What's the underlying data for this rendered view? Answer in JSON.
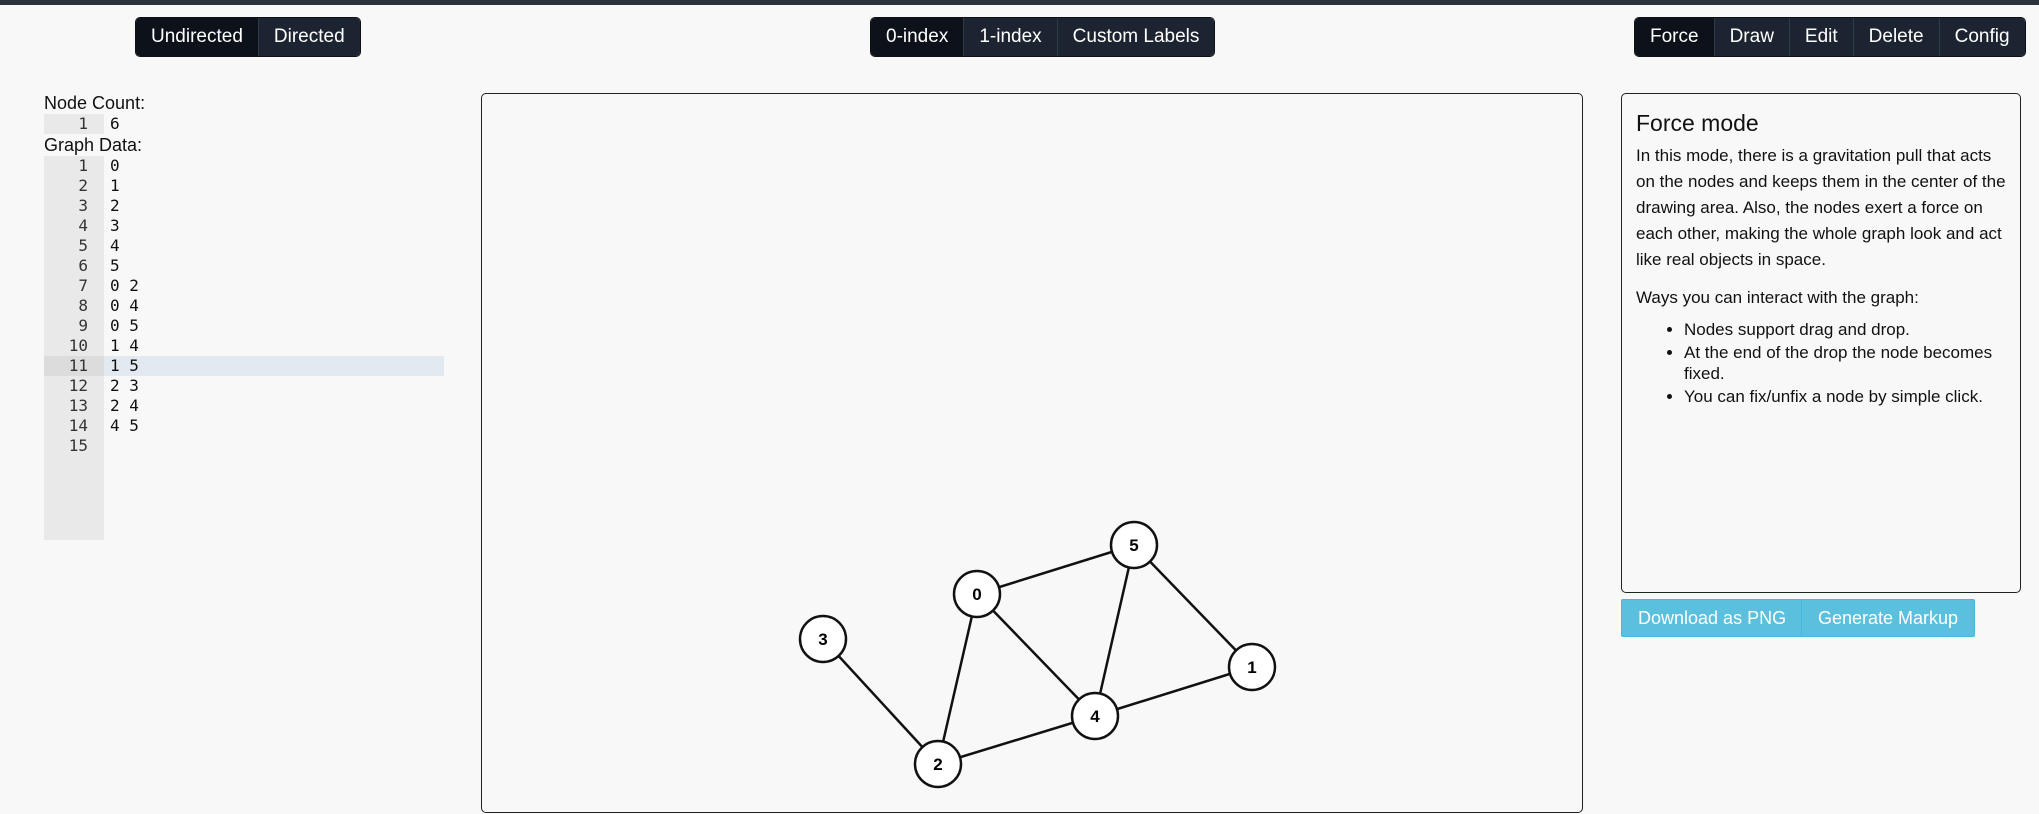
{
  "direction_toggle": {
    "buttons": [
      {
        "label": "Undirected"
      },
      {
        "label": "Directed"
      }
    ]
  },
  "index_toggle": {
    "buttons": [
      {
        "label": "0-index"
      },
      {
        "label": "1-index"
      },
      {
        "label": "Custom Labels"
      }
    ]
  },
  "mode_toggle": {
    "buttons": [
      {
        "label": "Force"
      },
      {
        "label": "Draw"
      },
      {
        "label": "Edit"
      },
      {
        "label": "Delete"
      },
      {
        "label": "Config"
      }
    ]
  },
  "node_count": {
    "label": "Node Count:",
    "lines": [
      {
        "num": "1",
        "text": "6"
      }
    ]
  },
  "graph_data": {
    "label": "Graph Data:",
    "lines": [
      {
        "num": "1",
        "text": "0"
      },
      {
        "num": "2",
        "text": "1"
      },
      {
        "num": "3",
        "text": "2"
      },
      {
        "num": "4",
        "text": "3"
      },
      {
        "num": "5",
        "text": "4"
      },
      {
        "num": "6",
        "text": "5"
      },
      {
        "num": "7",
        "text": "0 2"
      },
      {
        "num": "8",
        "text": "0 4"
      },
      {
        "num": "9",
        "text": "0 5"
      },
      {
        "num": "10",
        "text": "1 4"
      },
      {
        "num": "11",
        "text": "1 5"
      },
      {
        "num": "12",
        "text": "2 3"
      },
      {
        "num": "13",
        "text": "2 4"
      },
      {
        "num": "14",
        "text": "4 5"
      },
      {
        "num": "15",
        "text": ""
      }
    ]
  },
  "graph": {
    "nodes": [
      {
        "label": "0"
      },
      {
        "label": "1"
      },
      {
        "label": "2"
      },
      {
        "label": "3"
      },
      {
        "label": "4"
      },
      {
        "label": "5"
      }
    ]
  },
  "info": {
    "title": "Force mode",
    "paragraph": "In this mode, there is a gravitation pull that acts on the nodes and keeps them in the center of the drawing area. Also, the nodes exert a force on each other, making the whole graph look and act like real objects in space.",
    "ways_heading": "Ways you can interact with the graph:",
    "bullets": [
      "Nodes support drag and drop.",
      "At the end of the drop the node becomes fixed.",
      "You can fix/unfix a node by simple click."
    ]
  },
  "actions": {
    "download_label": "Download as PNG",
    "markup_label": "Generate Markup"
  }
}
